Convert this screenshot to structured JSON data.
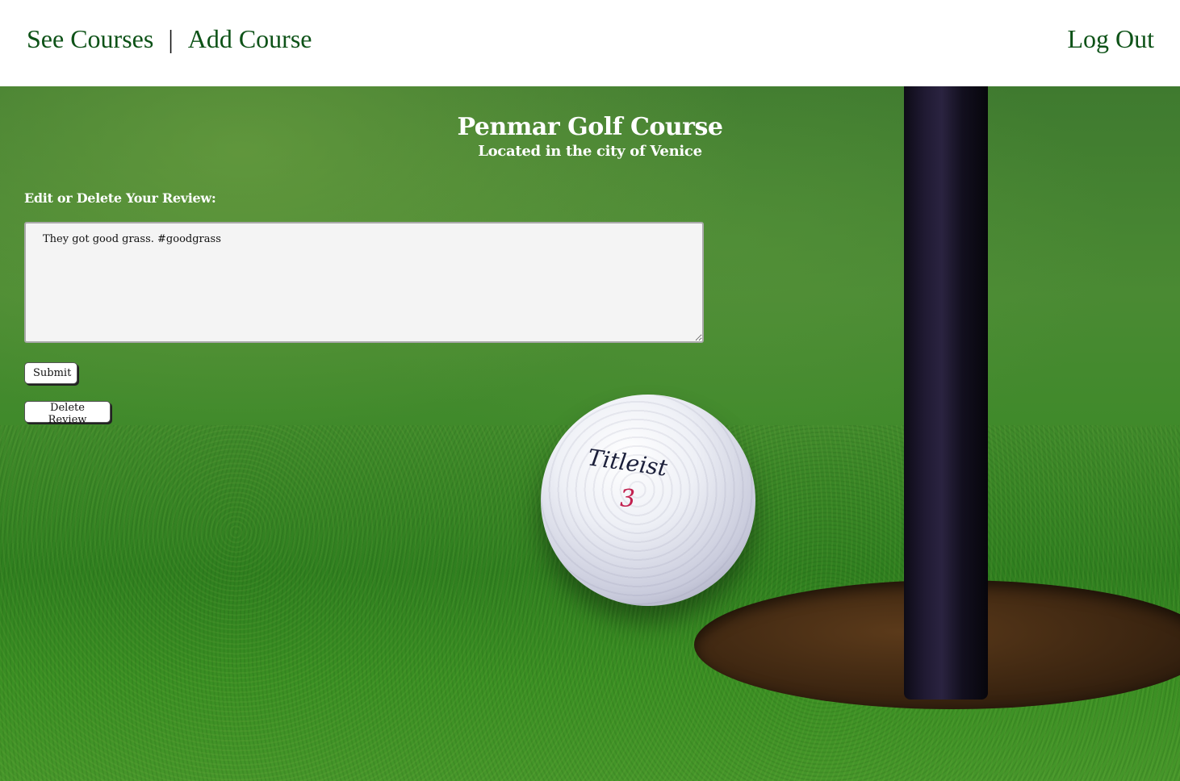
{
  "nav": {
    "see_courses": "See Courses",
    "separator": "|",
    "add_course": "Add Course",
    "log_out": "Log Out"
  },
  "course": {
    "name": "Penmar Golf Course",
    "location": "Located in the city of Venice"
  },
  "review": {
    "heading": "Edit or Delete Your Review:",
    "text": "They got good grass. #goodgrass",
    "submit_label": "Submit",
    "delete_label": "Delete Review"
  },
  "background": {
    "ball_brand": "Titleist",
    "ball_number": "3"
  },
  "colors": {
    "nav_link": "#0d5217",
    "heading_text": "#ffffff"
  }
}
